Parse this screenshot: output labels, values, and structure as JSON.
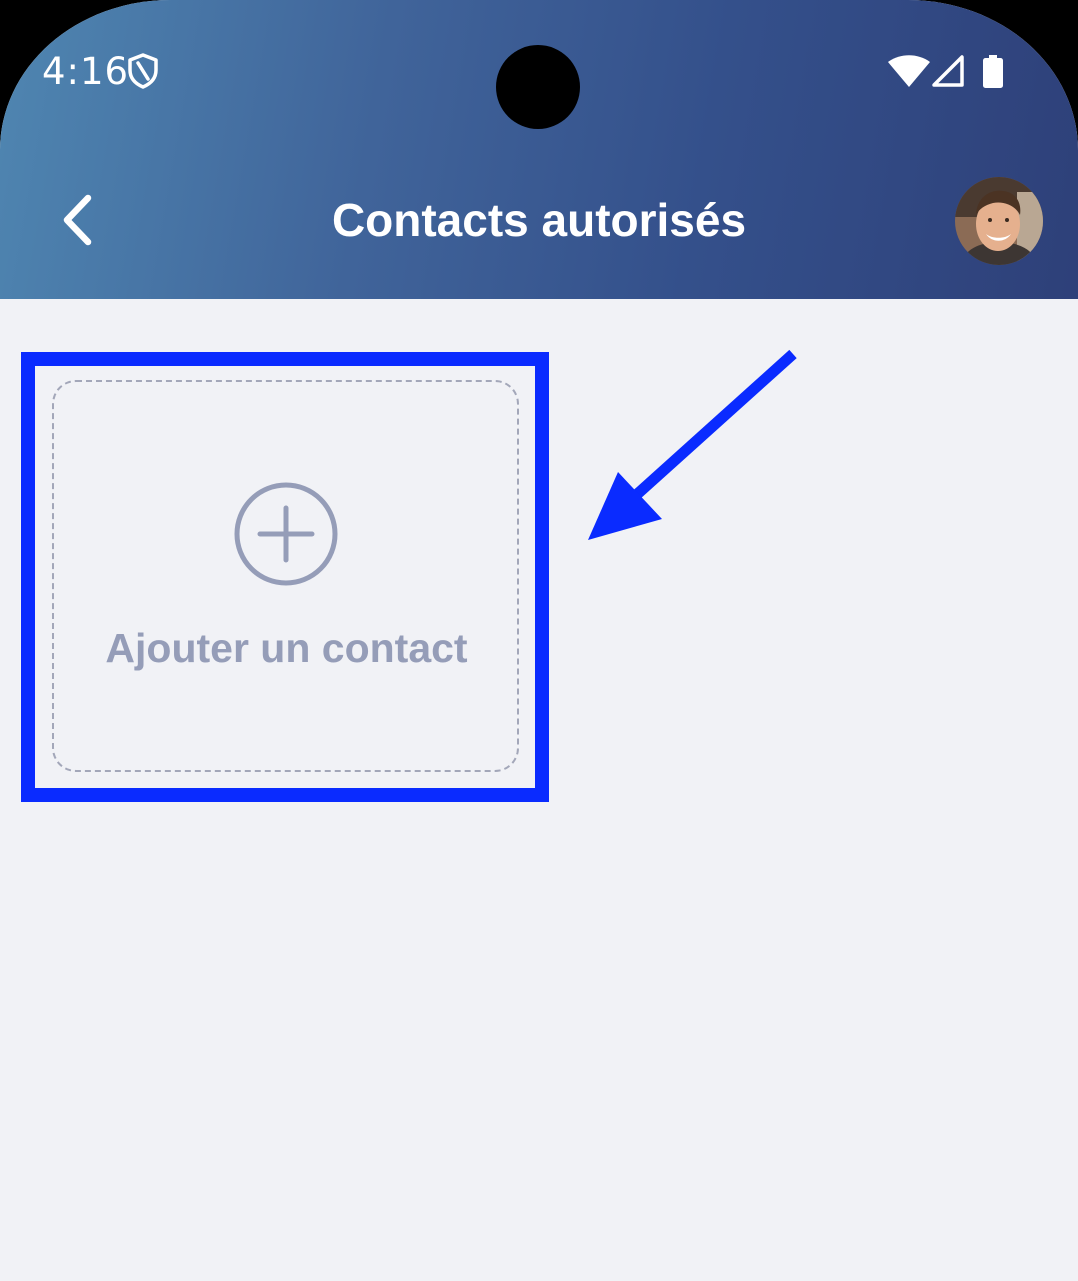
{
  "status_bar": {
    "time": "4:16",
    "icons": [
      "shield-icon",
      "wifi-icon",
      "signal-icon",
      "battery-icon"
    ]
  },
  "header": {
    "title": "Contacts autorisés",
    "back_icon": "chevron-left-icon",
    "avatar": "user-avatar"
  },
  "main": {
    "add_contact_label": "Ajouter un contact",
    "add_icon": "plus-circle-icon"
  },
  "annotation": {
    "highlight_color": "#0a2bff"
  },
  "colors": {
    "header_gradient_start": "#4f86b1",
    "header_gradient_end": "#2e4079",
    "background": "#f1f2f6",
    "muted_text": "#959db8"
  }
}
